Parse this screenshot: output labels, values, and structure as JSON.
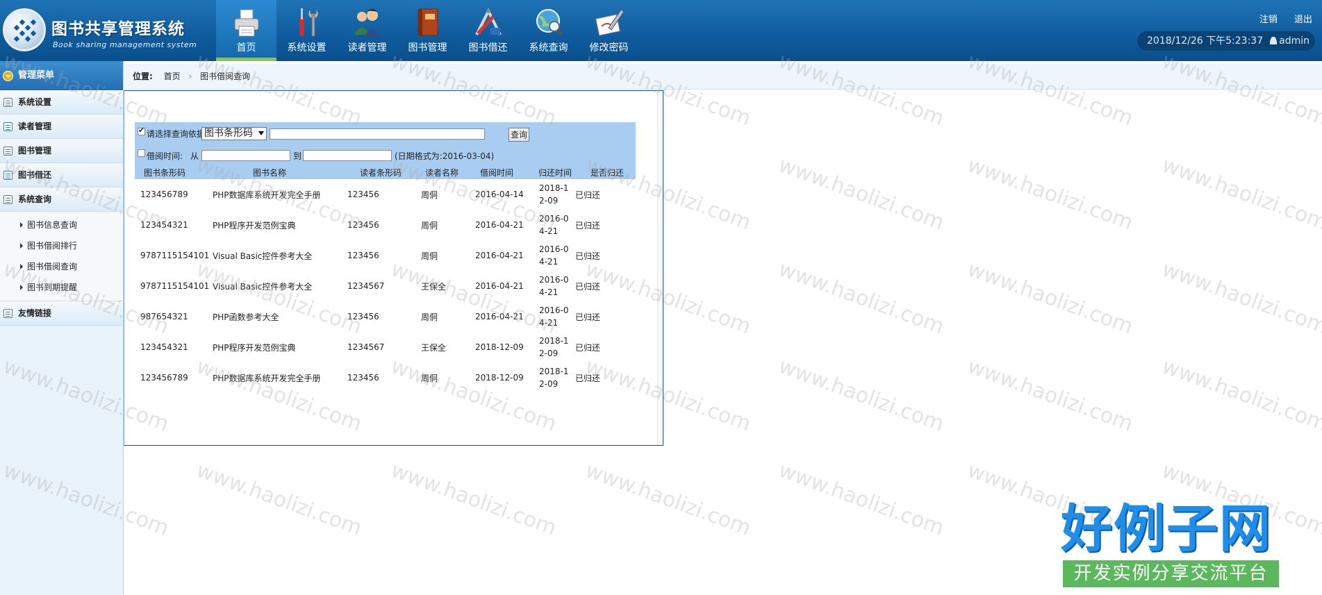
{
  "app": {
    "title": "图书共享管理系统",
    "subtitle": "Book sharing management system"
  },
  "nav": [
    {
      "label": "首页",
      "icon": "printer-icon",
      "active": true
    },
    {
      "label": "系统设置",
      "icon": "tools-icon",
      "active": false
    },
    {
      "label": "读者管理",
      "icon": "users-icon",
      "active": false
    },
    {
      "label": "图书管理",
      "icon": "book-icon",
      "active": false
    },
    {
      "label": "图书借还",
      "icon": "drafting-icon",
      "active": false
    },
    {
      "label": "系统查询",
      "icon": "globe-search-icon",
      "active": false
    },
    {
      "label": "修改密码",
      "icon": "pen-paper-icon",
      "active": false
    }
  ],
  "header": {
    "logout": "注销",
    "exit": "退出",
    "datetime": "2018/12/26 下午5:23:37",
    "user": "admin"
  },
  "sidebar": {
    "title": "管理菜单",
    "groups": [
      "系统设置",
      "读者管理",
      "图书管理",
      "图书借还",
      "系统查询"
    ],
    "sub_items": [
      "图书信息查询",
      "图书借阅排行",
      "图书借阅查询",
      "图书到期提醒"
    ],
    "links": "友情链接"
  },
  "breadcrumb": {
    "label": "位置:",
    "home": "首页",
    "current": "图书借阅查询"
  },
  "search": {
    "criteria_label": "请选择查询依据:",
    "criteria_value": "图书条形码",
    "query_button": "查询",
    "date_label": "借阅时间:",
    "from": "从",
    "to": "到",
    "date_hint": "(日期格式为:2016-03-04)"
  },
  "table": {
    "headers": [
      "图书条形码",
      "图书名称",
      "读者条形码",
      "读者名称",
      "借阅时间",
      "归还时间",
      "是否归还"
    ],
    "rows": [
      [
        "123456789",
        "PHP数据库系统开发完全手册",
        "123456",
        "周侗",
        "2016-04-14",
        "2018-12-09",
        "已归还"
      ],
      [
        "123454321",
        "PHP程序开发范例宝典",
        "123456",
        "周侗",
        "2016-04-21",
        "2016-04-21",
        "已归还"
      ],
      [
        "9787115154101",
        "Visual Basic控件参考大全",
        "123456",
        "周侗",
        "2016-04-21",
        "2016-04-21",
        "已归还"
      ],
      [
        "9787115154101",
        "Visual Basic控件参考大全",
        "1234567",
        "王保全",
        "2016-04-21",
        "2016-04-21",
        "已归还"
      ],
      [
        "987654321",
        "PHP函数参考大全",
        "123456",
        "周侗",
        "2016-04-21",
        "2016-04-21",
        "已归还"
      ],
      [
        "123454321",
        "PHP程序开发范例宝典",
        "1234567",
        "王保全",
        "2018-12-09",
        "2018-12-09",
        "已归还"
      ],
      [
        "123456789",
        "PHP数据库系统开发完全手册",
        "123456",
        "周侗",
        "2018-12-09",
        "2018-12-09",
        "已归还"
      ]
    ]
  },
  "watermark": {
    "text": "www.haolizi.com",
    "brand_big": "好例子网",
    "brand_small": "开发实例分享交流平台"
  }
}
